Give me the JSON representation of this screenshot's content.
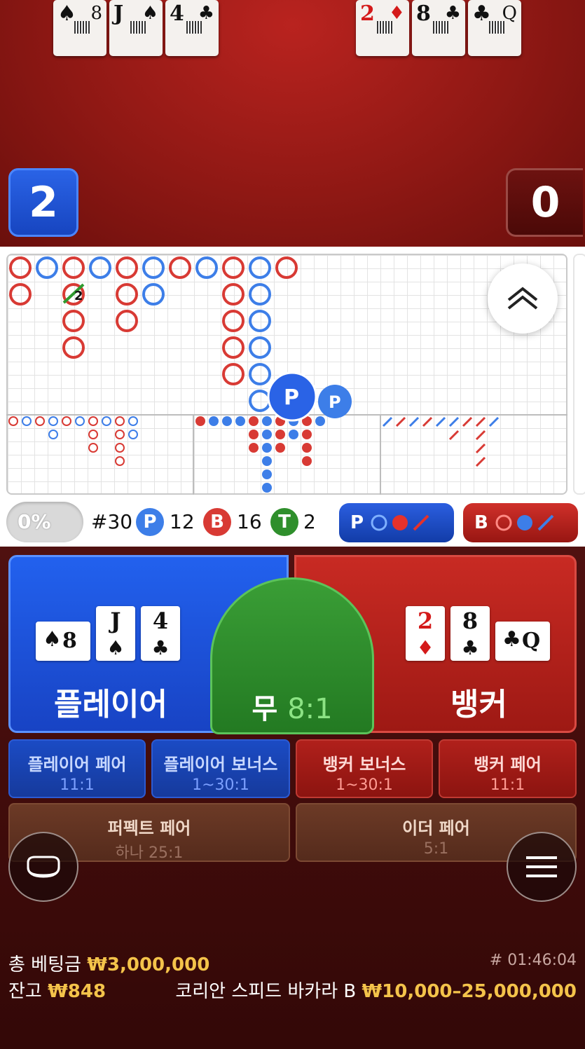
{
  "video": {
    "player_cards": [
      {
        "rank": "8",
        "suit": "♠",
        "color": "black"
      },
      {
        "rank": "J",
        "suit": "♠",
        "color": "black"
      },
      {
        "rank": "4",
        "suit": "♣",
        "color": "black"
      }
    ],
    "banker_cards": [
      {
        "rank": "2",
        "suit": "♦",
        "color": "red"
      },
      {
        "rank": "8",
        "suit": "♣",
        "color": "black"
      },
      {
        "rank": "Q",
        "suit": "♣",
        "color": "black"
      }
    ],
    "player_score": "2",
    "banker_score": "0"
  },
  "road": {
    "last_result_marker": "P",
    "next_marker": "P",
    "tie_count_mark": "2"
  },
  "stats": {
    "percent_toggle": "0%",
    "round_number": "#30",
    "player_chip": "P",
    "player_wins": "12",
    "banker_chip": "B",
    "banker_wins": "16",
    "tie_chip": "T",
    "tie_wins": "2",
    "player_predict_label": "P",
    "banker_predict_label": "B"
  },
  "betting": {
    "player_label": "플레이어",
    "banker_label": "뱅커",
    "tie_label": "무",
    "tie_odds": "8:1",
    "player_cards": [
      {
        "rank": "8",
        "suit": "♠"
      },
      {
        "rank": "J",
        "suit": "♠"
      },
      {
        "rank": "4",
        "suit": "♣"
      }
    ],
    "banker_cards": [
      {
        "rank": "2",
        "suit": "♦"
      },
      {
        "rank": "8",
        "suit": "♣"
      },
      {
        "rank": "Q",
        "suit": "♣"
      }
    ],
    "side_bets": [
      {
        "title": "플레이어 페어",
        "odds": "11:1"
      },
      {
        "title": "플레이어 보너스",
        "odds": "1~30:1"
      },
      {
        "title": "뱅커 보너스",
        "odds": "1~30:1"
      },
      {
        "title": "뱅커 페어",
        "odds": "11:1"
      },
      {
        "title": "퍼펙트 페어",
        "odds": "하나 25:1"
      },
      {
        "title": "이더 페어",
        "odds": "5:1"
      }
    ]
  },
  "footer": {
    "total_bet_label": "총 베팅금",
    "total_bet_value": "₩3,000,000",
    "balance_label": "잔고",
    "balance_value": "₩848",
    "round_id": "# 01:46:04",
    "table_name": "코리안 스피드 바카라 B",
    "bet_limits": "₩10,000–25,000,000"
  },
  "colors": {
    "player_blue": "#1d4fd8",
    "banker_red": "#c0211b",
    "tie_green": "#2f8f2c",
    "gold": "#f4c34a"
  }
}
